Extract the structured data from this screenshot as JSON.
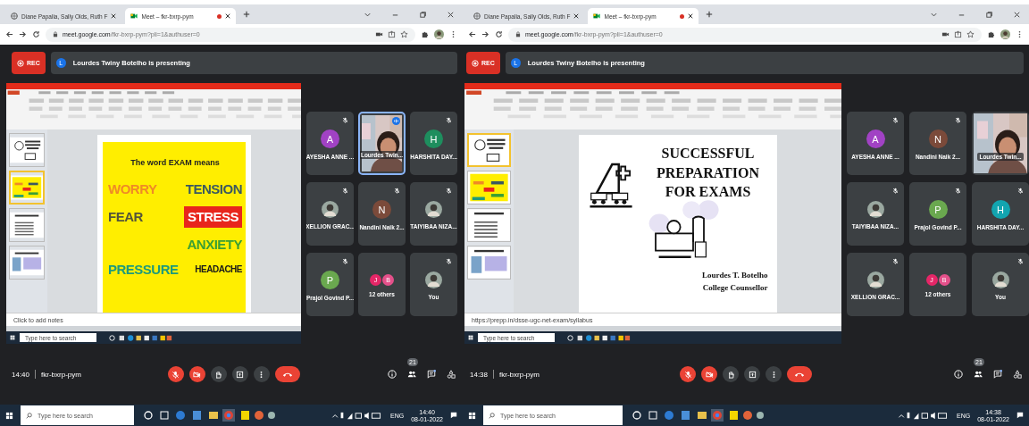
{
  "panels": [
    {
      "browser": {
        "tabs": [
          {
            "title": "Diane Papalia, Sally Olds, Ruth F",
            "selected": false,
            "recording": false
          },
          {
            "title": "Meet – fkr-bxrp-pym",
            "selected": true,
            "recording": true
          }
        ],
        "url_host": "meet.google.com",
        "url_path": "/fkr-bxrp-pym?pli=1&authuser=0"
      },
      "meet": {
        "rec_label": "REC",
        "presenter_initial": "L",
        "presenting_text": "Lourdes Twiny Botelho is presenting",
        "presentation": {
          "thumbnails": [
            {
              "kind": "title",
              "selected": false
            },
            {
              "kind": "words",
              "selected": true
            },
            {
              "kind": "list",
              "selected": false
            },
            {
              "kind": "pictures",
              "selected": false
            }
          ],
          "slide": {
            "kind": "word-cloud",
            "title": "The word EXAM means",
            "words": [
              {
                "text": "WORRY",
                "color": "#ef8a26",
                "boxed": false
              },
              {
                "text": "TENSION",
                "color": "#3b5860",
                "boxed": false
              },
              {
                "text": "FEAR",
                "color": "#55553a",
                "boxed": false
              },
              {
                "text": "STRESS",
                "color": "#e8261c",
                "boxed": true
              },
              {
                "text": "ANXIETY",
                "color": "#3a9f34",
                "boxed": false
              },
              {
                "text": "PRESSURE",
                "color": "#1f9a7a",
                "boxed": false
              },
              {
                "text": "HEADACHE",
                "color": "#1a1a1a",
                "boxed": false
              }
            ]
          },
          "notes": "Click to add notes",
          "taskbar_search": "Type here to search"
        },
        "tiles": [
          {
            "name": "AYESHA ANNE ...",
            "kind": "letter",
            "initial": "A",
            "color": "#a142c4",
            "muted": true,
            "speaking": false
          },
          {
            "name": "Lourdes Twin...",
            "kind": "video",
            "muted": false,
            "speaking": true
          },
          {
            "name": "HARSHITA DAY...",
            "kind": "letter",
            "initial": "H",
            "color": "#1e8e5e",
            "muted": true,
            "speaking": false
          },
          {
            "name": "XELLION GRAC...",
            "muted": true,
            "speaking": false
          },
          {
            "name": "Nandini Naik 2...",
            "kind": "letter",
            "initial": "N",
            "color": "#7b4a3a",
            "muted": true,
            "speaking": false
          },
          {
            "name": "TAIYIBAA NIZA...",
            "muted": true,
            "speaking": false
          },
          {
            "name": "Prajol Govind P...",
            "kind": "letter",
            "initial": "P",
            "color": "#6aa84f",
            "muted": true,
            "speaking": false
          },
          {
            "name": "12 others",
            "kind": "group",
            "avatars": [
              {
                "initial": "J",
                "color": "#e52667"
              },
              {
                "initial": "B",
                "color": "#e4508a"
              }
            ],
            "muted": false,
            "speaking": false
          },
          {
            "name": "You",
            "muted": true,
            "speaking": false
          }
        ],
        "time": "14:40",
        "meeting_code": "fkr-bxrp-pym",
        "controls": [
          {
            "kind": "mic",
            "off": true
          },
          {
            "kind": "camera",
            "off": true
          },
          {
            "kind": "hand"
          },
          {
            "kind": "present"
          },
          {
            "kind": "more"
          },
          {
            "kind": "end"
          }
        ],
        "participant_count": "21"
      },
      "taskbar": {
        "search_placeholder": "Type here to search",
        "language": "ENG",
        "time": "14:40",
        "date": "08-01-2022"
      }
    },
    {
      "browser": {
        "tabs": [
          {
            "title": "Diane Papalia, Sally Olds, Ruth F",
            "selected": false,
            "recording": false
          },
          {
            "title": "Meet – fkr-bxrp-pym",
            "selected": true,
            "recording": true
          }
        ],
        "url_host": "meet.google.com",
        "url_path": "/fkr-bxrp-pym?pli=1&authuser=0"
      },
      "meet": {
        "rec_label": "REC",
        "presenter_initial": "L",
        "presenting_text": "Lourdes Twiny Botelho is presenting",
        "presentation": {
          "thumbnails": [
            {
              "kind": "title",
              "selected": true
            },
            {
              "kind": "words",
              "selected": false
            },
            {
              "kind": "list",
              "selected": false
            },
            {
              "kind": "pictures",
              "selected": false
            }
          ],
          "slide": {
            "kind": "title",
            "heading": "SUCCESSFUL PREPARATION FOR EXAMS",
            "author": "Lourdes T. Botelho",
            "role": "College Counsellor"
          },
          "notes": "https://prepp.in/dsse-ugc-net-exam/syllabus",
          "taskbar_search": "Type here to search"
        },
        "tiles": [
          {
            "name": "AYESHA ANNE ...",
            "kind": "letter",
            "initial": "A",
            "color": "#a142c4",
            "muted": true,
            "speaking": false
          },
          {
            "name": "Nandini Naik 2...",
            "kind": "letter",
            "initial": "N",
            "color": "#7b4a3a",
            "muted": true,
            "speaking": false
          },
          {
            "name": "Lourdes Twin...",
            "kind": "video",
            "muted": false,
            "speaking": false
          },
          {
            "name": "TAIYIBAA NIZA...",
            "muted": true,
            "speaking": false
          },
          {
            "name": "Prajol Govind P...",
            "kind": "letter",
            "initial": "P",
            "color": "#6aa84f",
            "muted": true,
            "speaking": false
          },
          {
            "name": "HARSHITA DAY...",
            "kind": "letter",
            "initial": "H",
            "color": "#12a4af",
            "muted": true,
            "speaking": false
          },
          {
            "name": "XELLION GRAC...",
            "muted": true,
            "speaking": false
          },
          {
            "name": "12 others",
            "kind": "group",
            "avatars": [
              {
                "initial": "J",
                "color": "#e52667"
              },
              {
                "initial": "B",
                "color": "#e4508a"
              }
            ],
            "muted": false,
            "speaking": false
          },
          {
            "name": "You",
            "muted": true,
            "speaking": false
          }
        ],
        "time": "14:38",
        "meeting_code": "fkr-bxrp-pym",
        "controls": [
          {
            "kind": "mic",
            "off": true
          },
          {
            "kind": "camera",
            "off": true
          },
          {
            "kind": "hand"
          },
          {
            "kind": "present"
          },
          {
            "kind": "more"
          },
          {
            "kind": "end"
          }
        ],
        "participant_count": "21"
      },
      "taskbar": {
        "search_placeholder": "Type here to search",
        "language": "ENG",
        "time": "14:38",
        "date": "08-01-2022"
      }
    }
  ]
}
